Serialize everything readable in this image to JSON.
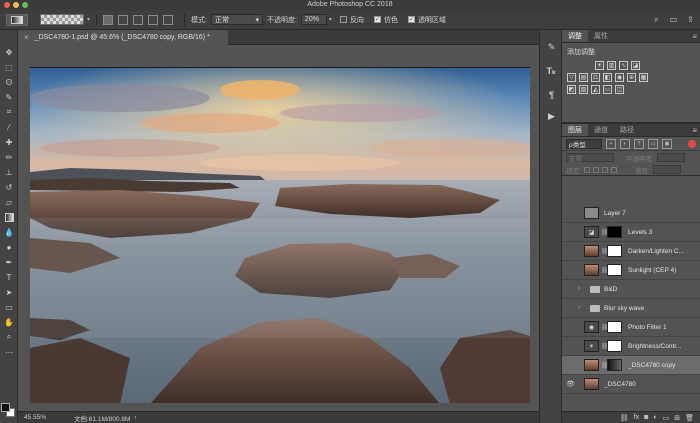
{
  "window": {
    "title": "Adobe Photoshop CC 2018"
  },
  "options_bar": {
    "mode_label": "模式:",
    "mode_value": "正常",
    "opacity_label": "不透明度:",
    "opacity_value": "20%",
    "reverse_label": "反向",
    "dither_label": "仿色",
    "transparency_label": "透明区域",
    "reverse_checked": false,
    "dither_checked": true,
    "transparency_checked": true
  },
  "document": {
    "tab_title": "_DSC4780-1.psd @ 45.6% (_DSC4780 copy, RGB/16) *",
    "zoom": "45.55%",
    "doc_size": "文档:61.1M/800.8M"
  },
  "adjustments_panel": {
    "tabs": [
      "调整",
      "属性"
    ],
    "title": "添加调整",
    "row1": [
      "sun",
      "levels",
      "curves",
      "exposure"
    ],
    "row2": [
      "vibrance",
      "huesat",
      "colorbalance",
      "bw",
      "photofilter",
      "channelmixer",
      "lookup"
    ],
    "row3": [
      "invert",
      "posterize",
      "threshold",
      "gradientmap",
      "selectivecolor"
    ]
  },
  "layers_panel": {
    "tabs": [
      "图层",
      "通道",
      "路径"
    ],
    "filter_kind": "ρ类型",
    "blend_mode": "正常",
    "opacity_label": "不透明度:",
    "lock_label": "锁定:",
    "fill_label": "填充:",
    "layers": [
      {
        "name": "Layer 7",
        "visible": false,
        "type": "pixel",
        "thumb": "#8a8a8a"
      },
      {
        "name": "Levels 3",
        "visible": false,
        "type": "adjustment",
        "mask": "black"
      },
      {
        "name": "Darken/Lighten C...",
        "visible": false,
        "type": "adjustment-photo",
        "mask": "white"
      },
      {
        "name": "Sunlight (CEP 4)",
        "visible": false,
        "type": "adjustment-photo",
        "mask": "white"
      },
      {
        "name": "B&D",
        "visible": false,
        "type": "group"
      },
      {
        "name": "Blur sky wave",
        "visible": false,
        "type": "group"
      },
      {
        "name": "Photo Filter 1",
        "visible": false,
        "type": "adjustment",
        "mask": "white"
      },
      {
        "name": "Brightness/Contr...",
        "visible": false,
        "type": "adjustment",
        "mask": "white"
      },
      {
        "name": "_DSC4780 copy",
        "visible": false,
        "type": "pixel-photo-mask",
        "selected": true
      },
      {
        "name": "_DSC4780",
        "visible": true,
        "type": "photo"
      }
    ]
  },
  "colors": {
    "accent": "#6c6c6c",
    "panel_bg": "#535353",
    "bar_bg": "#3e3e3e"
  }
}
